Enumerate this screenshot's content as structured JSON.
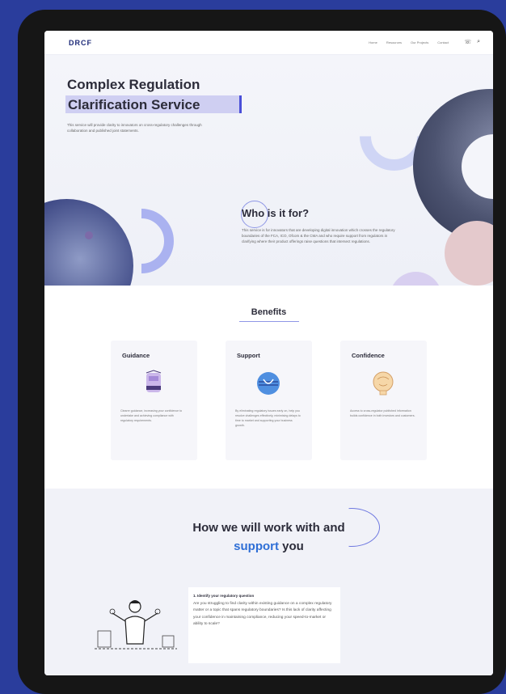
{
  "colors": {
    "background": "#2a3d9c",
    "accent": "#2f6fd6",
    "highlight": "#cfcff2",
    "text": "#2c2c3a"
  },
  "nav": {
    "logo": "DRCF",
    "links": [
      "Home",
      "Resources",
      "Our Projects",
      "Contact"
    ],
    "icons": [
      "phone-icon",
      "search-icon"
    ]
  },
  "hero": {
    "title_line1": "Complex Regulation",
    "title_line2": "Clarification Service",
    "description": "This service will provide clarity to innovators on cross-regulatory challenges through collaboration and published joint statements."
  },
  "who": {
    "title": "Who is it for?",
    "description": "This service is for innovators that are developing digital innovation which crosses the regulatory boundaries of the FCA, ICO, Ofcom & the CMA and who require support from regulators in clarifying where their product offerings raise questions that intersect regulations."
  },
  "benefits": {
    "title": "Benefits",
    "cards": [
      {
        "title": "Guidance",
        "icon": "shield-illustration",
        "text": "Clearer guidance, increasing your confidence to undertake and achieving compliance with regulatory requirements."
      },
      {
        "title": "Support",
        "icon": "handshake-illustration",
        "text": "By eliminating regulatory issues early on, help you resolve challenges effectively, minimising delays to time to market and supporting your business growth."
      },
      {
        "title": "Confidence",
        "icon": "head-illustration",
        "text": "Access to cross-regulator published information builds confidence in both investors and customers."
      }
    ]
  },
  "how": {
    "title_line1": "How we will work with and",
    "title_accent": "support",
    "title_rest": " you",
    "step": {
      "title": "1. Identify your regulatory question",
      "text": "Are you struggling to find clarity within existing guidance on a complex regulatory matter or a topic that spans regulatory boundaries? Is this lack of clarity affecting your confidence in maintaining compliance, reducing your speed-to-market or ability to scale?"
    }
  }
}
